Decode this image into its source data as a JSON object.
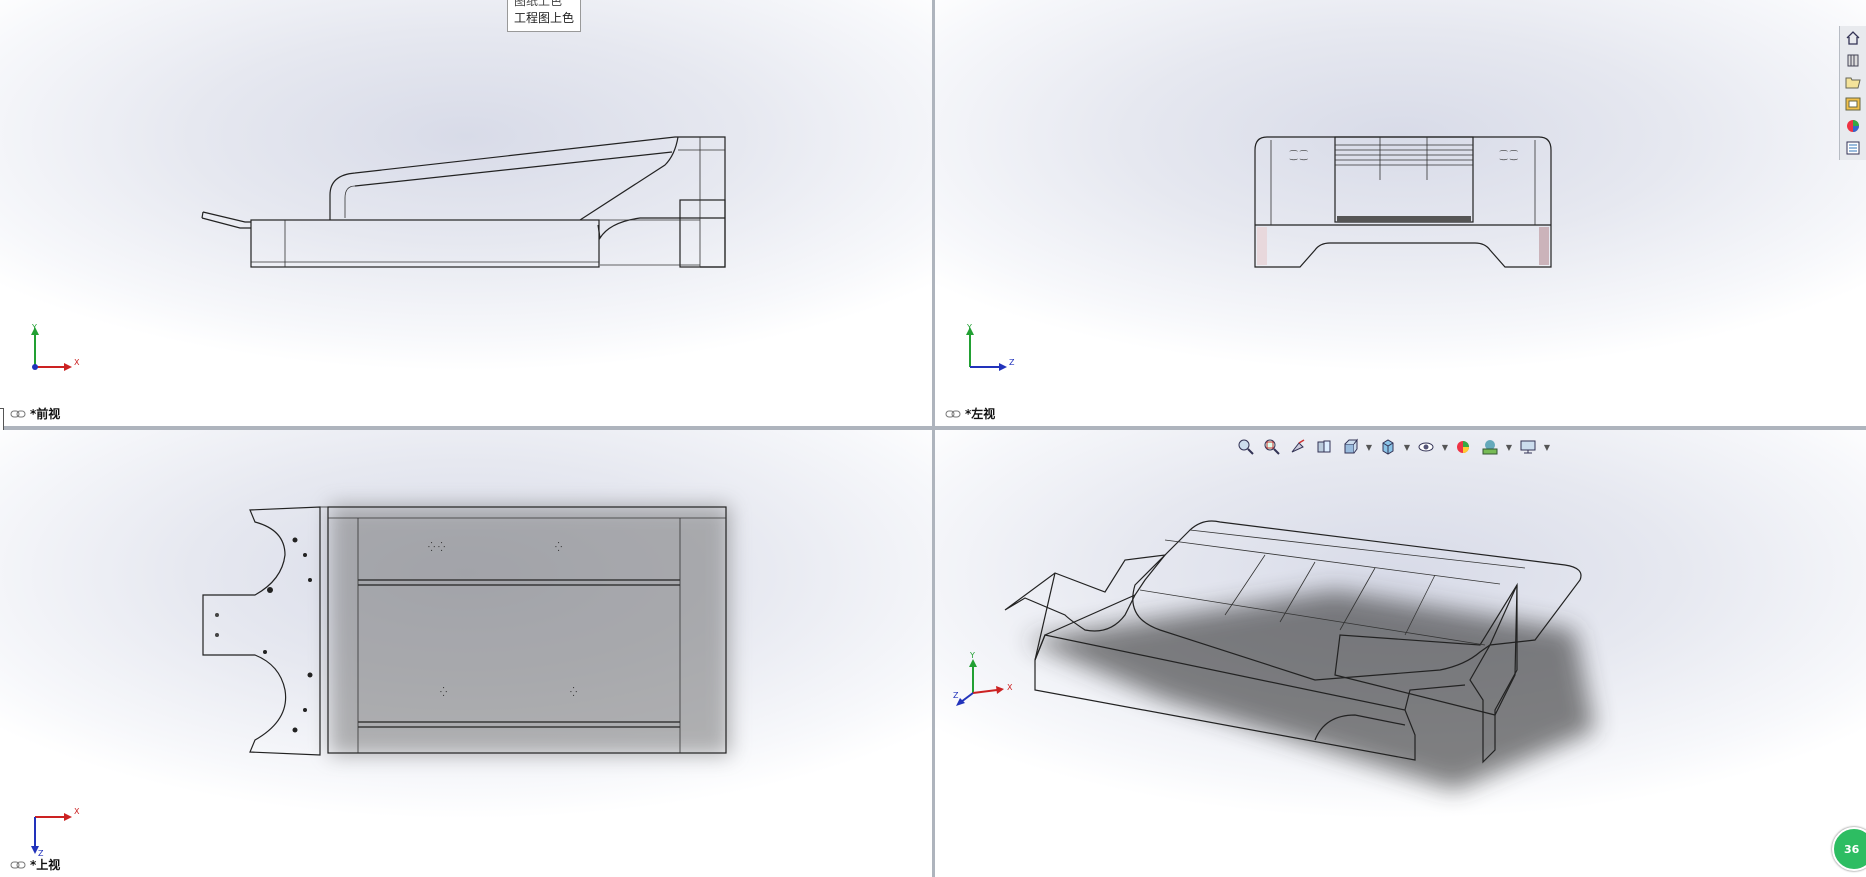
{
  "tooltip": {
    "line1": "图纸上色",
    "line2": "工程图上色"
  },
  "viewports": {
    "front": {
      "label": "*前视",
      "axes": [
        "Y",
        "X"
      ]
    },
    "left": {
      "label": "*左视",
      "axes": [
        "Y",
        "Z"
      ]
    },
    "top": {
      "label": "*上视",
      "axes": [
        "X",
        "Z"
      ]
    },
    "iso": {
      "axes": [
        "Y",
        "X",
        "Z"
      ],
      "badge": "36"
    }
  },
  "hud_icons": [
    "zoom-to-fit-icon",
    "zoom-area-icon",
    "previous-view-icon",
    "section-view-icon",
    "view-orientation-icon",
    "display-style-icon",
    "hide-show-icon",
    "edit-appearance-icon",
    "apply-scene-icon",
    "view-settings-icon"
  ],
  "taskpane_icons": [
    "home-icon",
    "parts-library-icon",
    "file-explorer-icon",
    "view-palette-icon",
    "appearances-icon",
    "custom-properties-icon"
  ],
  "colors": {
    "axis_x": "#cc2222",
    "axis_y": "#22a033",
    "axis_z": "#2233bb",
    "badge": "#2dbd62"
  }
}
